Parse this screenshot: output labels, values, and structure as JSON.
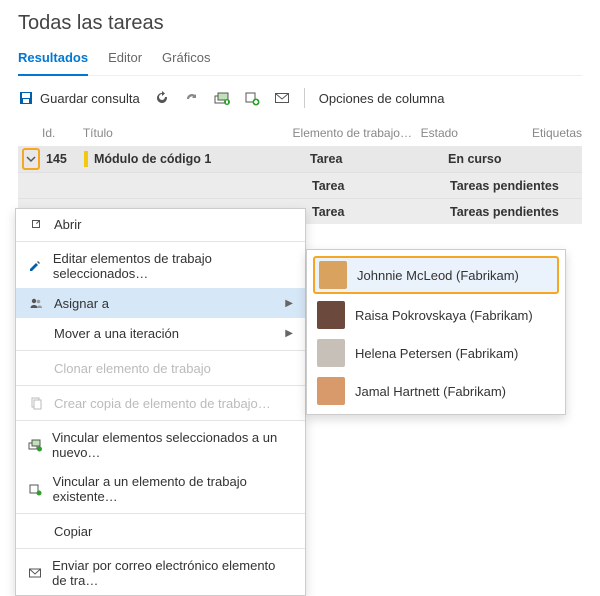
{
  "title": "Todas las tareas",
  "tabs": {
    "results": "Resultados",
    "editor": "Editor",
    "charts": "Gráficos"
  },
  "toolbar": {
    "save_query": "Guardar consulta",
    "column_options": "Opciones de columna"
  },
  "columns": {
    "id": "Id.",
    "title": "Título",
    "type": "Elemento de trabajo…",
    "state": "Estado",
    "tags": "Etiquetas"
  },
  "rows": [
    {
      "id": "145",
      "title": "Módulo de código 1",
      "type": "Tarea",
      "state": "En curso"
    },
    {
      "id": "",
      "title": "",
      "type": "Tarea",
      "state": "Tareas pendientes"
    },
    {
      "id": "",
      "title": "",
      "type": "Tarea",
      "state": "Tareas pendientes"
    }
  ],
  "menu": {
    "open": "Abrir",
    "edit_selected": "Editar elementos de trabajo seleccionados…",
    "assign_to": "Asignar a",
    "move_iteration": "Mover a una iteración",
    "clone": "Clonar elemento de trabajo",
    "create_copy": "Crear copia de elemento de trabajo…",
    "link_selected_new": "Vincular elementos seleccionados a un nuevo…",
    "link_existing": "Vincular a un elemento de trabajo existente…",
    "copy": "Copiar",
    "email": "Enviar por correo electrónico elemento de tra…"
  },
  "people": [
    {
      "name": "Johnnie McLeod (Fabrikam)",
      "avatar": "#d9a25e"
    },
    {
      "name": "Raisa Pokrovskaya (Fabrikam)",
      "avatar": "#6b4a3d"
    },
    {
      "name": "Helena Petersen (Fabrikam)",
      "avatar": "#c7c0b8"
    },
    {
      "name": "Jamal Hartnett (Fabrikam)",
      "avatar": "#d89a6a"
    }
  ]
}
